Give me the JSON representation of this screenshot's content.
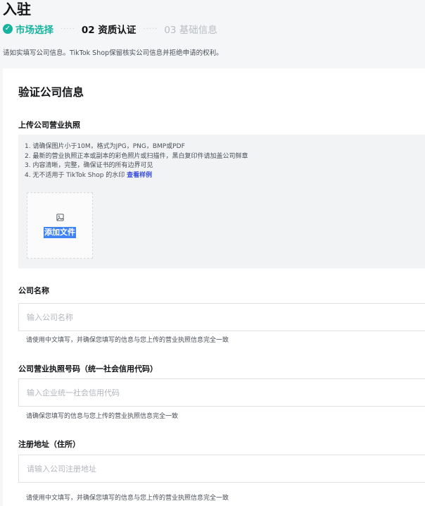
{
  "header": {
    "title": "入驻",
    "steps": [
      {
        "label": "市场选择",
        "status": "done"
      },
      {
        "label": "02 资质认证",
        "status": "active"
      },
      {
        "label": "03 基础信息",
        "status": "pending"
      }
    ],
    "step_separator": "·····",
    "check_glyph": "✓",
    "intro": "请如实填写公司信息。TikTok Shop保留核实公司信息并拒绝申请的权利。"
  },
  "card": {
    "title": "验证公司信息",
    "license_upload": {
      "label": "上传公司营业执照",
      "rules": [
        "1. 请确保图片小于10M，格式为JPG，PNG，BMP或PDF",
        "2. 最新的营业执照正本或副本的彩色照片或扫描件，黑白复印件请加盖公司鲜章",
        "3. 内容清晰，完整，确保证书的所有边界可见"
      ],
      "rule4_text": "4. 无不适用于 TikTok Shop 的水印 ",
      "sample_link": "查看样例",
      "upload_icon": "image-icon",
      "upload_button": "添加文件"
    },
    "company_name": {
      "label": "公司名称",
      "placeholder": "输入公司名称",
      "value": "",
      "helper": "请使用中文填写，并确保您填写的信息与您上传的营业执照信息完全一致"
    },
    "license_number": {
      "label": "公司营业执照号码（统一社会信用代码）",
      "placeholder": "输入企业统一社会信用代码",
      "value": "",
      "helper": "请确保您填写的信息与您上传的营业执照信息完全一致"
    },
    "registered_address": {
      "label": "注册地址（住所）",
      "placeholder": "请输入公司注册地址",
      "value": "",
      "helper": "请使用中文填写，并确保您填写的信息与您上传的营业执照信息完全一致"
    }
  },
  "colors": {
    "accent_green": "#16b39e",
    "link_blue": "#3a4ee0",
    "selection_blue": "#3f83f5"
  }
}
